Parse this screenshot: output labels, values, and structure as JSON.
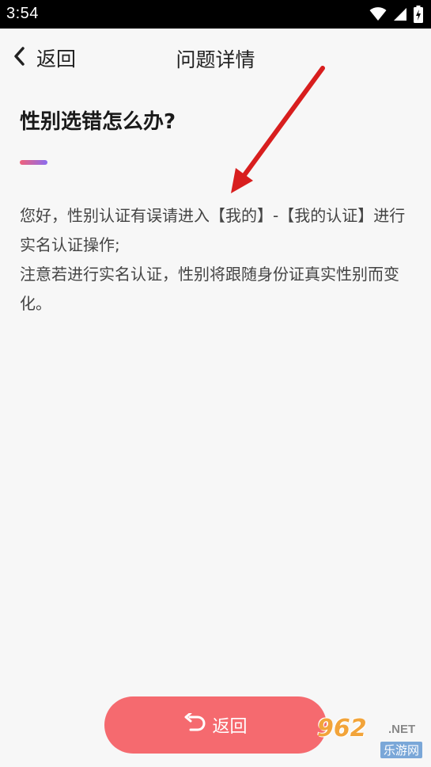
{
  "status_bar": {
    "time": "3:54"
  },
  "nav": {
    "back_label": "返回",
    "title": "问题详情"
  },
  "question": {
    "title": "性别选错怎么办?"
  },
  "answer": {
    "line1": "您好，性别认证有误请进入【我的】-【我的认证】进行实名认证操作;",
    "line2": "注意若进行实名认证，性别将跟随身份证真实性别而变化。"
  },
  "bottom_button": {
    "label": "返回"
  },
  "watermark": {
    "brand": "962",
    "suffix": ".NET",
    "sub": "乐游网"
  },
  "colors": {
    "button": "#f56a6f",
    "accent_start": "#f0627a",
    "accent_end": "#8a6cf0",
    "arrow": "#d81e1e"
  }
}
